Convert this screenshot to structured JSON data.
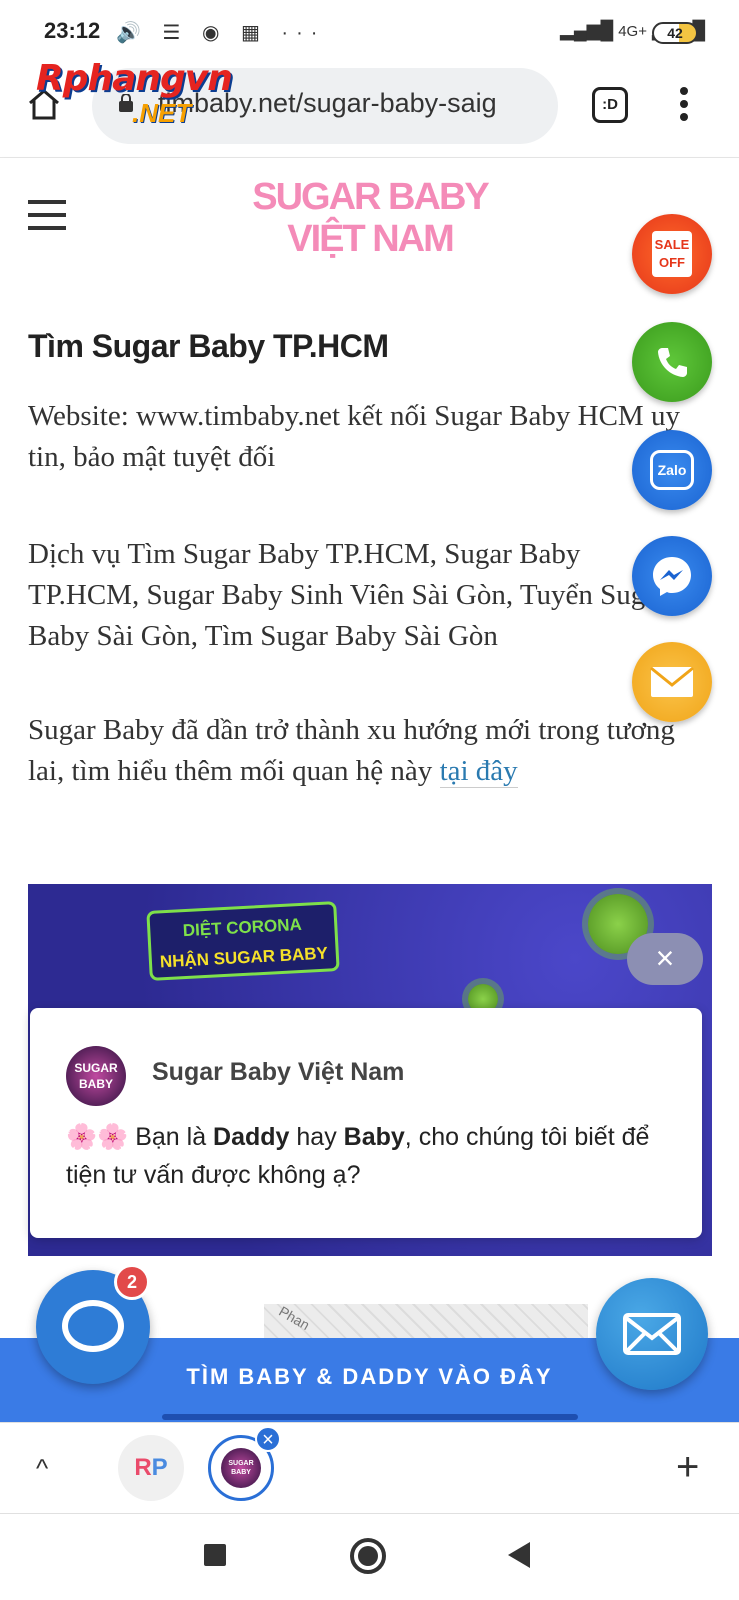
{
  "status_bar": {
    "time": "23:12",
    "icons": "🔊 ☰ ◉ ▦ ···",
    "network": "4G+",
    "battery": "42"
  },
  "browser": {
    "url": "timbaby.net/sugar-baby-saig",
    "tab_count_label": ":D",
    "overlay_logo": {
      "main": "Rphangvn",
      "suffix": ".NET"
    }
  },
  "site": {
    "brand_line1": "SUGAR BABY",
    "brand_line2": "VIỆT NAM"
  },
  "article": {
    "title": "Tìm Sugar Baby TP.HCM",
    "p1": "Website: www.timbaby.net kết nối Sugar Baby HCM uy tin, bảo mật tuyệt đối",
    "p2": "Dịch vụ Tìm Sugar Baby TP.HCM, Sugar Baby TP.HCM, Sugar Baby Sinh Viên Sài Gòn, Tuyển Sugar Baby Sài Gòn, Tìm Sugar Baby Sài Gòn",
    "p3_text": "Sugar Baby đã dần trở thành xu hướng mới trong tương lai, tìm hiểu thêm mối quan hệ này ",
    "p3_link": "tại đây"
  },
  "floating_buttons": {
    "sale_label": "SALE OFF",
    "zalo_label": "Zalo"
  },
  "banner": {
    "line1": "DIỆT CORONA",
    "line2": "NHẬN SUGAR BABY"
  },
  "chat_popup": {
    "close_label": "×",
    "avatar_text": "SUGAR BABY",
    "name": "Sugar Baby Việt Nam",
    "emoji": "🌸🌸",
    "msg_a": " Bạn là ",
    "msg_daddy": "Daddy",
    "msg_b": " hay ",
    "msg_baby": "Baby",
    "msg_c": ", cho chúng tôi biết để tiện tư vấn được không ạ?"
  },
  "messenger": {
    "badge_count": "2"
  },
  "cta": {
    "label": "TÌM BABY & DADDY VÀO ĐÂY",
    "map_text": "Phan"
  },
  "tab_strip": {
    "up_label": "^",
    "rp_left": "R",
    "rp_right": "P",
    "current_tab_text": "SUGAR BABY",
    "close_label": "×",
    "add_label": "+"
  }
}
